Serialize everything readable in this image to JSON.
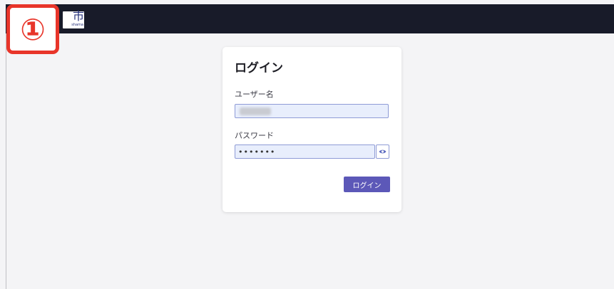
{
  "header": {
    "logo_kanji": "市",
    "logo_sub": "shama"
  },
  "badge": {
    "text": "①"
  },
  "login": {
    "title": "ログイン",
    "username_label": "ユーザー名",
    "password_label": "パスワード",
    "password_value": "•••••••",
    "submit_label": "ログイン"
  },
  "colors": {
    "topbar": "#181b29",
    "badge_red": "#e8352a",
    "button": "#5c58b8",
    "input_bg": "#e8eefc"
  },
  "icons": {
    "show_password": "eye-icon"
  }
}
